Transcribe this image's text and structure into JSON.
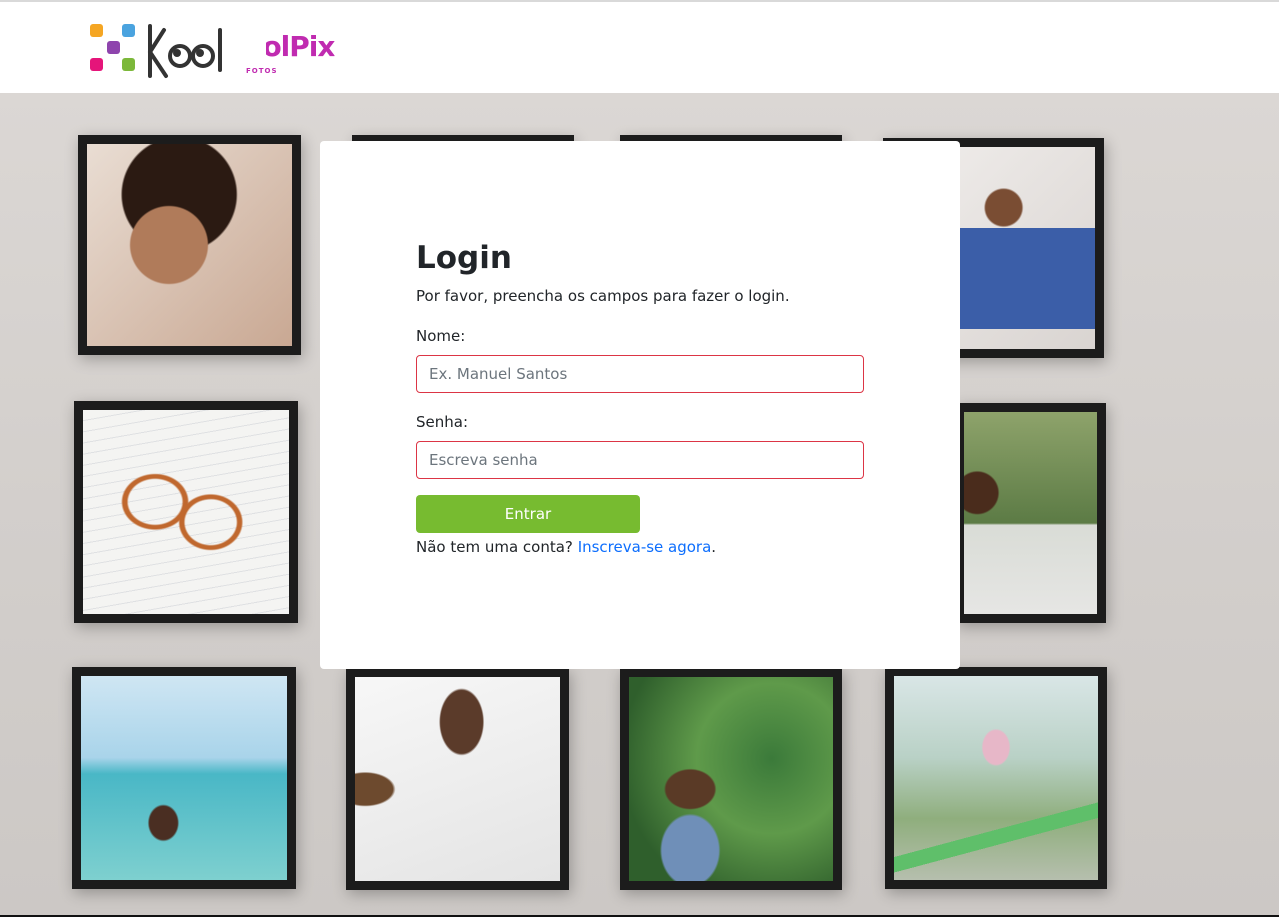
{
  "header": {
    "logo_icon": "koolpix-logo",
    "logo_text_main": "KoolPix",
    "logo_text_sub": "FOTOS"
  },
  "photos": [
    {
      "icon": "photo-smiling-child"
    },
    {
      "icon": "photo-toddler-blue-dress"
    },
    {
      "icon": "photo-glasses-on-notebook"
    },
    {
      "icon": "photo-child-bubbles"
    },
    {
      "icon": "photo-horse-in-sea"
    },
    {
      "icon": "photo-sleeping-child"
    },
    {
      "icon": "photo-child-picking-berries"
    },
    {
      "icon": "photo-child-on-seesaw"
    }
  ],
  "login": {
    "title": "Login",
    "subtitle": "Por favor, preencha os campos para fazer o login.",
    "name_label": "Nome:",
    "name_placeholder": "Ex. Manuel Santos",
    "name_value": "",
    "password_label": "Senha:",
    "password_placeholder": "Escreva senha",
    "password_value": "",
    "submit_label": "Entrar",
    "signup_prompt": "Não tem uma conta?",
    "signup_link": "Inscreva-se agora",
    "signup_suffix": "."
  },
  "colors": {
    "accent": "#77bb30",
    "link": "#0d6efd",
    "input_border": "#dc3545",
    "logo_magenta": "#c02bb0"
  }
}
